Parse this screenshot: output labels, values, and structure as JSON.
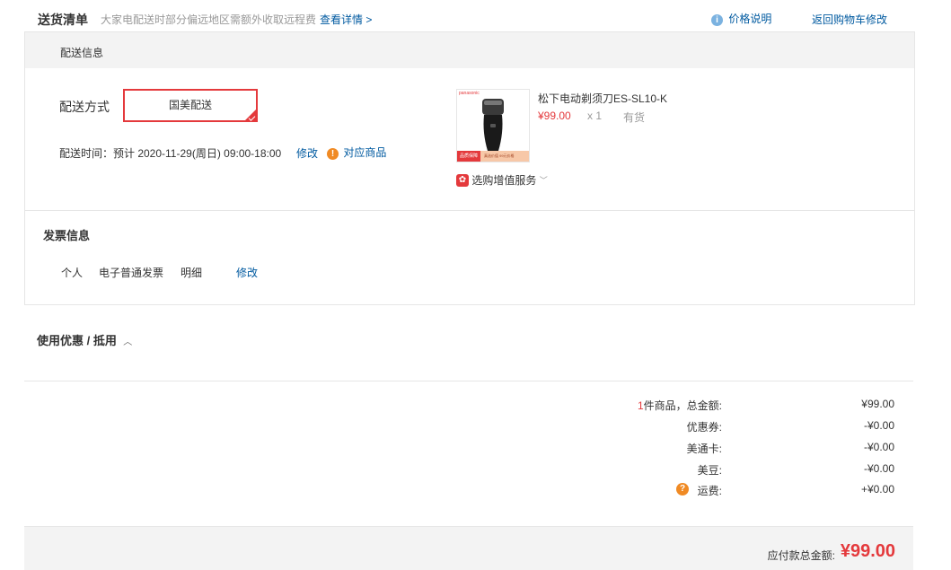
{
  "header": {
    "title": "送货清单",
    "notice": "大家电配送时部分偏远地区需额外收取远程费",
    "details_link": "查看详情 >",
    "price_info_link": "价格说明",
    "back_to_cart_link": "返回购物车修改"
  },
  "delivery": {
    "section_title": "配送信息",
    "method_label": "配送方式",
    "method_selected": "国美配送",
    "time_label": "配送时间：预计 2020-11-29(周日) 09:00-18:00",
    "modify_link": "修改",
    "matching_products_link": "对应商品"
  },
  "product": {
    "name": "松下电动剃须刀ES-SL10-K",
    "price": "¥99.00",
    "quantity": "x 1",
    "stock": "有货",
    "value_added_service": "选购增值服务",
    "image_logo_text": "panasonic",
    "image_badge": "品质保障",
    "image_banner": "真选价值 99元价格"
  },
  "invoice": {
    "section_title": "发票信息",
    "type": "个人",
    "kind": "电子普通发票",
    "content": "明细",
    "modify_link": "修改"
  },
  "coupon": {
    "section_title": "使用优惠 / 抵用"
  },
  "summary": {
    "count_number": "1",
    "count_label": "件商品，总金额:",
    "total_value": "¥99.00",
    "coupon_label": "优惠券:",
    "coupon_value": "-¥0.00",
    "meitong_label": "美通卡:",
    "meitong_value": "-¥0.00",
    "meidou_label": "美豆:",
    "meidou_value": "-¥0.00",
    "shipping_label": "运费:",
    "shipping_value": "+¥0.00"
  },
  "footer": {
    "payable_label": "应付款总金额:",
    "payable_value": "¥99.00"
  },
  "colors": {
    "accent_red": "#e4393c",
    "link_blue": "#005aa0",
    "warning_orange": "#f08a24"
  }
}
